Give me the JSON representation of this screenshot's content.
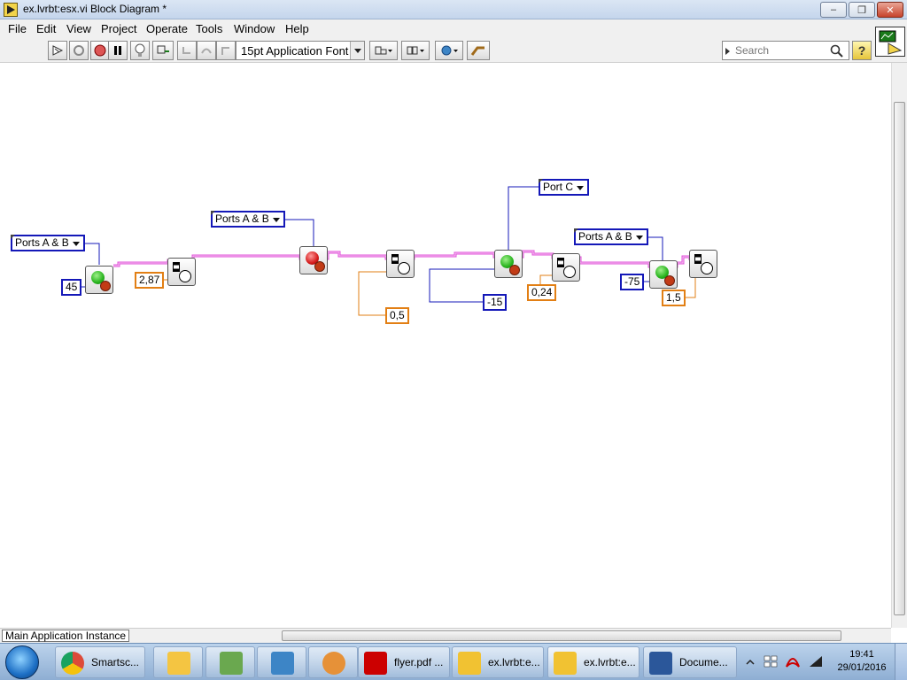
{
  "window": {
    "title": "ex.lvrbt:esx.vi Block Diagram *",
    "minimize_glyph": "–",
    "restore_glyph": "❐",
    "close_glyph": "✕"
  },
  "menu": [
    "File",
    "Edit",
    "View",
    "Project",
    "Operate",
    "Tools",
    "Window",
    "Help"
  ],
  "toolbar": {
    "font_select": "15pt Application Font",
    "search_placeholder": "Search",
    "help_glyph": "?"
  },
  "diagram": {
    "rings": {
      "ports_ab_1": "Ports A & B",
      "ports_ab_2": "Ports A & B",
      "port_c": "Port C",
      "ports_ab_3": "Ports A & B"
    },
    "constants": {
      "power_45": "45",
      "wait_287": "2,87",
      "wait_05": "0,5",
      "power_m15": "-15",
      "wait_024": "0,24",
      "power_m75": "-75",
      "wait_15": "1,5"
    }
  },
  "statusbar": {
    "instance": "Main Application Instance"
  },
  "taskbar": {
    "items": [
      {
        "label": "Smartsc...",
        "color": "#dd4b39"
      },
      {
        "label": "",
        "color": "#f4c542"
      },
      {
        "label": "",
        "color": "#6aa84f"
      },
      {
        "label": "",
        "color": "#3d85c6"
      },
      {
        "label": "",
        "color": "#e69138"
      },
      {
        "label": "flyer.pdf ...",
        "color": "#cc0000"
      },
      {
        "label": "ex.lvrbt:e...",
        "color": "#f1c232"
      },
      {
        "label": "ex.lvrbt:e...",
        "color": "#f1c232"
      },
      {
        "label": "Docume...",
        "color": "#2b579a"
      }
    ],
    "time": "19:41",
    "date": "29/01/2016"
  },
  "colors": {
    "wire_error": "#e050d8",
    "wire_numeric": "#e27f14",
    "wire_ring": "#1418b8"
  }
}
